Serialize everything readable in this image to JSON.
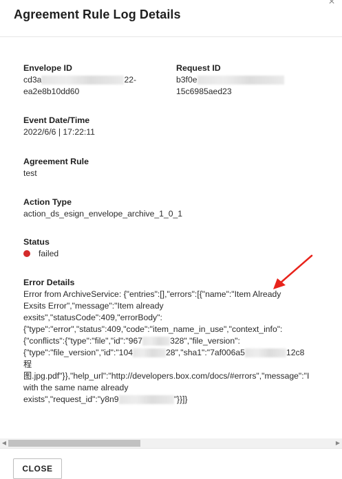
{
  "modal": {
    "title": "Agreement Rule Log Details",
    "close_icon_glyph": "×"
  },
  "fields": {
    "envelope_id": {
      "label": "Envelope ID",
      "line1_prefix": "cd3a",
      "line1_suffix": "22-",
      "line2": "ea2e8b10dd60"
    },
    "request_id": {
      "label": "Request ID",
      "line1_prefix": "b3f0e",
      "line2": "15c6985aed23"
    },
    "event_datetime": {
      "label": "Event Date/Time",
      "value": "2022/6/6 | 17:22:11"
    },
    "agreement_rule": {
      "label": "Agreement Rule",
      "value": "test"
    },
    "action_type": {
      "label": "Action Type",
      "value": "action_ds_esign_envelope_archive_1_0_1"
    },
    "status": {
      "label": "Status",
      "value": "failed",
      "color": "#d42a2a"
    },
    "error_details": {
      "label": "Error Details",
      "lines": [
        "Error from ArchiveService: {\"entries\":[],\"errors\":[{\"name\":\"Item Already",
        "Exsits Error\",\"message\":\"Item already",
        "exsits\",\"statusCode\":409,\"errorBody\":",
        "{\"type\":\"error\",\"status\":409,\"code\":\"item_name_in_use\",\"context_info\":",
        "{\"conflicts\":{\"type\":\"file\",\"id\":\"967",
        "{\"type\":\"file_version\",\"id\":\"104",
        "程",
        "图.jpg.pdf\"}},\"help_url\":\"http://developers.box.com/docs/#errors\",\"message\":\"I",
        "with the same name already",
        "exists\",\"request_id\":\"y8n9"
      ],
      "line5_tail": "328\",\"file_version\":",
      "line6_mid": "28\",\"sha1\":\"7af006a5",
      "line6_tail": "12c8",
      "line10_tail": "\"}}]}"
    }
  },
  "footer": {
    "close_label": "CLOSE"
  },
  "scrollbar": {
    "left_arrow": "◀",
    "right_arrow": "▶"
  },
  "colors": {
    "status_failed": "#d42a2a",
    "annotation_arrow": "#e8231b"
  }
}
